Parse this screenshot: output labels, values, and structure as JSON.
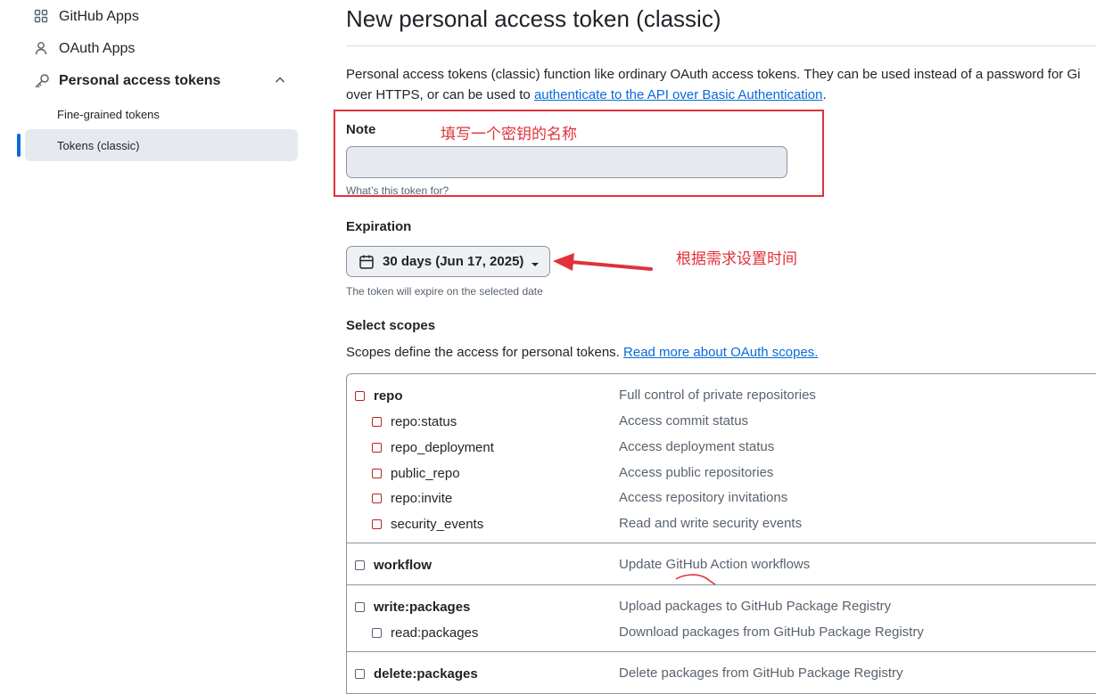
{
  "sidebar": {
    "items": [
      {
        "label": "GitHub Apps",
        "icon": "apps-grid-icon"
      },
      {
        "label": "OAuth Apps",
        "icon": "person-icon"
      },
      {
        "label": "Personal access tokens",
        "icon": "key-icon"
      }
    ],
    "sub_items": [
      {
        "label": "Fine-grained tokens",
        "active": false
      },
      {
        "label": "Tokens (classic)",
        "active": true
      }
    ]
  },
  "main": {
    "title": "New personal access token (classic)",
    "intro_text": "Personal access tokens (classic) function like ordinary OAuth access tokens. They can be used instead of a password for Gi",
    "intro_text_2": "over HTTPS, or can be used to ",
    "intro_link": "authenticate to the API over Basic Authentication",
    "intro_end": "."
  },
  "note": {
    "label": "Note",
    "value": "",
    "placeholder": "",
    "help": "What’s this token for?",
    "annotation": "填写一个密钥的名称"
  },
  "expiration": {
    "label": "Expiration",
    "selected": "30 days (Jun 17, 2025)",
    "help": "The token will expire on the selected date",
    "annotation": "根据需求设置时间"
  },
  "scopes": {
    "label": "Select scopes",
    "desc": "Scopes define the access for personal tokens. ",
    "desc_link": "Read more about OAuth scopes.",
    "rows": [
      {
        "name": "repo",
        "desc": "Full control of private repositories",
        "top": true
      },
      {
        "name": "repo:status",
        "desc": "Access commit status",
        "top": false
      },
      {
        "name": "repo_deployment",
        "desc": "Access deployment status",
        "top": false
      },
      {
        "name": "public_repo",
        "desc": "Access public repositories",
        "top": false
      },
      {
        "name": "repo:invite",
        "desc": "Access repository invitations",
        "top": false
      },
      {
        "name": "security_events",
        "desc": "Read and write security events",
        "top": false
      },
      {
        "name": "workflow",
        "desc": "Update GitHub Action workflows",
        "top": true
      },
      {
        "name": "write:packages",
        "desc": "Upload packages to GitHub Package Registry",
        "top": true
      },
      {
        "name": "read:packages",
        "desc": "Download packages from GitHub Package Registry",
        "top": false
      },
      {
        "name": "delete:packages",
        "desc": "Delete packages from GitHub Package Registry",
        "top": true
      }
    ]
  },
  "colors": {
    "annotation_red": "#e0323a",
    "link_blue": "#0969da",
    "active_bg": "#e6eaef"
  }
}
